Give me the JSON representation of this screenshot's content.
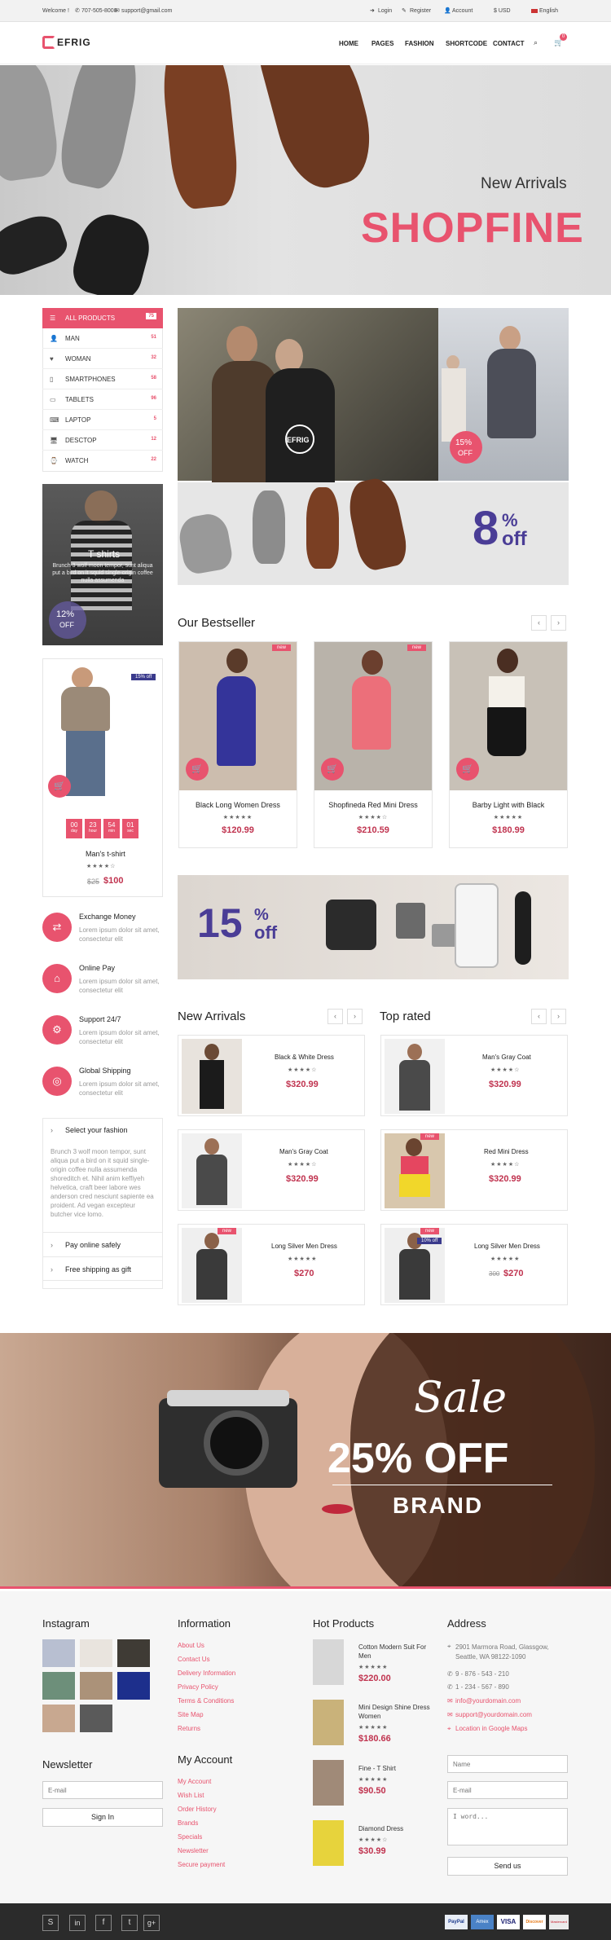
{
  "topbar": {
    "welcome": "Welcome !",
    "phone": "707-505-8008",
    "email": "support@gmail.com",
    "login": "Login",
    "register": "Register",
    "account": "Account",
    "currency": "$ USD",
    "language": "English"
  },
  "header": {
    "logo": "EFRIG",
    "cart_count": "0",
    "nav": [
      "HOME",
      "PAGES",
      "FASHION",
      "SHORTCODE",
      "CONTACT"
    ]
  },
  "hero": {
    "subtitle": "New Arrivals",
    "title": "SHOPFINE"
  },
  "categories": [
    {
      "label": "ALL PRODUCTS",
      "count": "75",
      "icon": "list-icon"
    },
    {
      "label": "MAN",
      "count": "51",
      "icon": "user-icon"
    },
    {
      "label": "WOMAN",
      "count": "32",
      "icon": "heart-icon"
    },
    {
      "label": "SMARTPHONES",
      "count": "58",
      "icon": "phone-icon"
    },
    {
      "label": "TABLETS",
      "count": "96",
      "icon": "tablet-icon"
    },
    {
      "label": "LAPTOP",
      "count": "5",
      "icon": "laptop-icon"
    },
    {
      "label": "DESCTOP",
      "count": "12",
      "icon": "desktop-icon"
    },
    {
      "label": "WATCH",
      "count": "22",
      "icon": "watch-icon"
    }
  ],
  "promo_tshirt": {
    "title": "T shirts",
    "text": "Brunch 3 wolf moon tempor, sunt aliqua put a bird on it squid single-origin coffee nulla assumenda",
    "discount": "12%",
    "off": "OFF"
  },
  "deal": {
    "badge": "15% off",
    "days": "00",
    "hours": "23",
    "mins": "54",
    "secs": "01",
    "day_lbl": "day",
    "hour_lbl": "hour",
    "min_lbl": "min",
    "sec_lbl": "sec",
    "name": "Man's t-shirt",
    "old_price": "$25",
    "price": "$100"
  },
  "features": [
    {
      "title": "Exchange Money",
      "text": "Lorem ipsum dolor sit amet, consectetur elit",
      "icon": "exchange-icon"
    },
    {
      "title": "Online Pay",
      "text": "Lorem ipsum dolor sit amet, consectetur elit",
      "icon": "tag-icon"
    },
    {
      "title": "Support 24/7",
      "text": "Lorem ipsum dolor sit amet, consectetur elit",
      "icon": "sliders-icon"
    },
    {
      "title": "Global Shipping",
      "text": "Lorem ipsum dolor sit amet, consectetur elit",
      "icon": "globe-icon"
    }
  ],
  "accordion": {
    "item1": "Select your fashion",
    "item1_text": "Brunch 3 wolf moon tempor, sunt aliqua put a bird on it squid single-origin coffee nulla assumenda shoreditch et. Nihil anim keffiyeh helvetica, craft beer labore wes anderson cred nesciunt sapiente ea proident. Ad vegan excepteur butcher vice lomo.",
    "item2": "Pay online safely",
    "item3": "Free shipping as gift"
  },
  "banner_top": {
    "discount": "15%",
    "off": "OFF",
    "logo": "EFRIG"
  },
  "banner_shoes": {
    "big": "8",
    "pct": "%",
    "off": "off"
  },
  "bestseller": {
    "title": "Our Bestseller",
    "products": [
      {
        "name": "Black Long Women Dress",
        "price": "$120.99",
        "badge": "new"
      },
      {
        "name": "Shopfineda Red Mini Dress",
        "price": "$210.59",
        "badge": "new"
      },
      {
        "name": "Barby Light with Black",
        "price": "$180.99",
        "badge": ""
      }
    ]
  },
  "banner_mid": {
    "big": "15",
    "pct": "%",
    "off": "off"
  },
  "new_arrivals": {
    "title": "New Arrivals",
    "items": [
      {
        "name": "Black & White Dress",
        "price": "$320.99"
      },
      {
        "name": "Man's Gray Coat",
        "price": "$320.99"
      },
      {
        "name": "Long Silver Men Dress",
        "price": "$270",
        "badge": "new"
      }
    ]
  },
  "top_rated": {
    "title": "Top rated",
    "items": [
      {
        "name": "Man's Gray Coat",
        "price": "$320.99"
      },
      {
        "name": "Red Mini Dress",
        "price": "$320.99",
        "badge": "new"
      },
      {
        "name": "Long Silver Men Dress",
        "old": "300",
        "price": "$270",
        "badge": "new",
        "badge2": "10% off"
      }
    ]
  },
  "sale": {
    "script": "Sale",
    "pct": "25% OFF",
    "brand": "BRAND"
  },
  "footer": {
    "instagram": "Instagram",
    "information": "Information",
    "info_links": [
      "About Us",
      "Contact Us",
      "Delivery Information",
      "Privacy Policy",
      "Terms & Conditions",
      "Site Map",
      "Returns"
    ],
    "account": "My Account",
    "account_links": [
      "My Account",
      "Wish List",
      "Order History",
      "Brands",
      "Specials",
      "Newsletter",
      "Secure payment"
    ],
    "hot": "Hot Products",
    "hot_items": [
      {
        "name": "Cotton Modern Suit For Men",
        "price": "$220.00"
      },
      {
        "name": "Mini Design Shine Dress Women",
        "price": "$180.66"
      },
      {
        "name": "Fine - T Shirt",
        "price": "$90.50"
      },
      {
        "name": "Diamond Dress",
        "price": "$30.99"
      }
    ],
    "address": "Address",
    "addr_line1": "2901 Marmora Road, Glassgow, Seattle, WA 98122-1090",
    "phone1": "9 - 876 - 543 - 210",
    "phone2": "1 - 234 - 567 - 890",
    "mail1": "info@yourdomain.com",
    "mail2": "support@yourdomain.com",
    "map": "Location in Google Maps",
    "newsletter": "Newsletter",
    "email_ph": "E-mail",
    "signin": "Sign In",
    "name_ph": "Name",
    "word_ph": "I word...",
    "send": "Send us"
  },
  "bottom": {
    "social": [
      "skype-icon",
      "linkedin-icon",
      "facebook-icon",
      "twitter-icon",
      "google-plus-icon"
    ],
    "payments": [
      "PayPal",
      "Amex",
      "VISA",
      "Discover",
      "Mastercard"
    ]
  },
  "colors": {
    "accent": "#e8536e",
    "dark": "#333333",
    "indigo": "#3a3a8c"
  }
}
